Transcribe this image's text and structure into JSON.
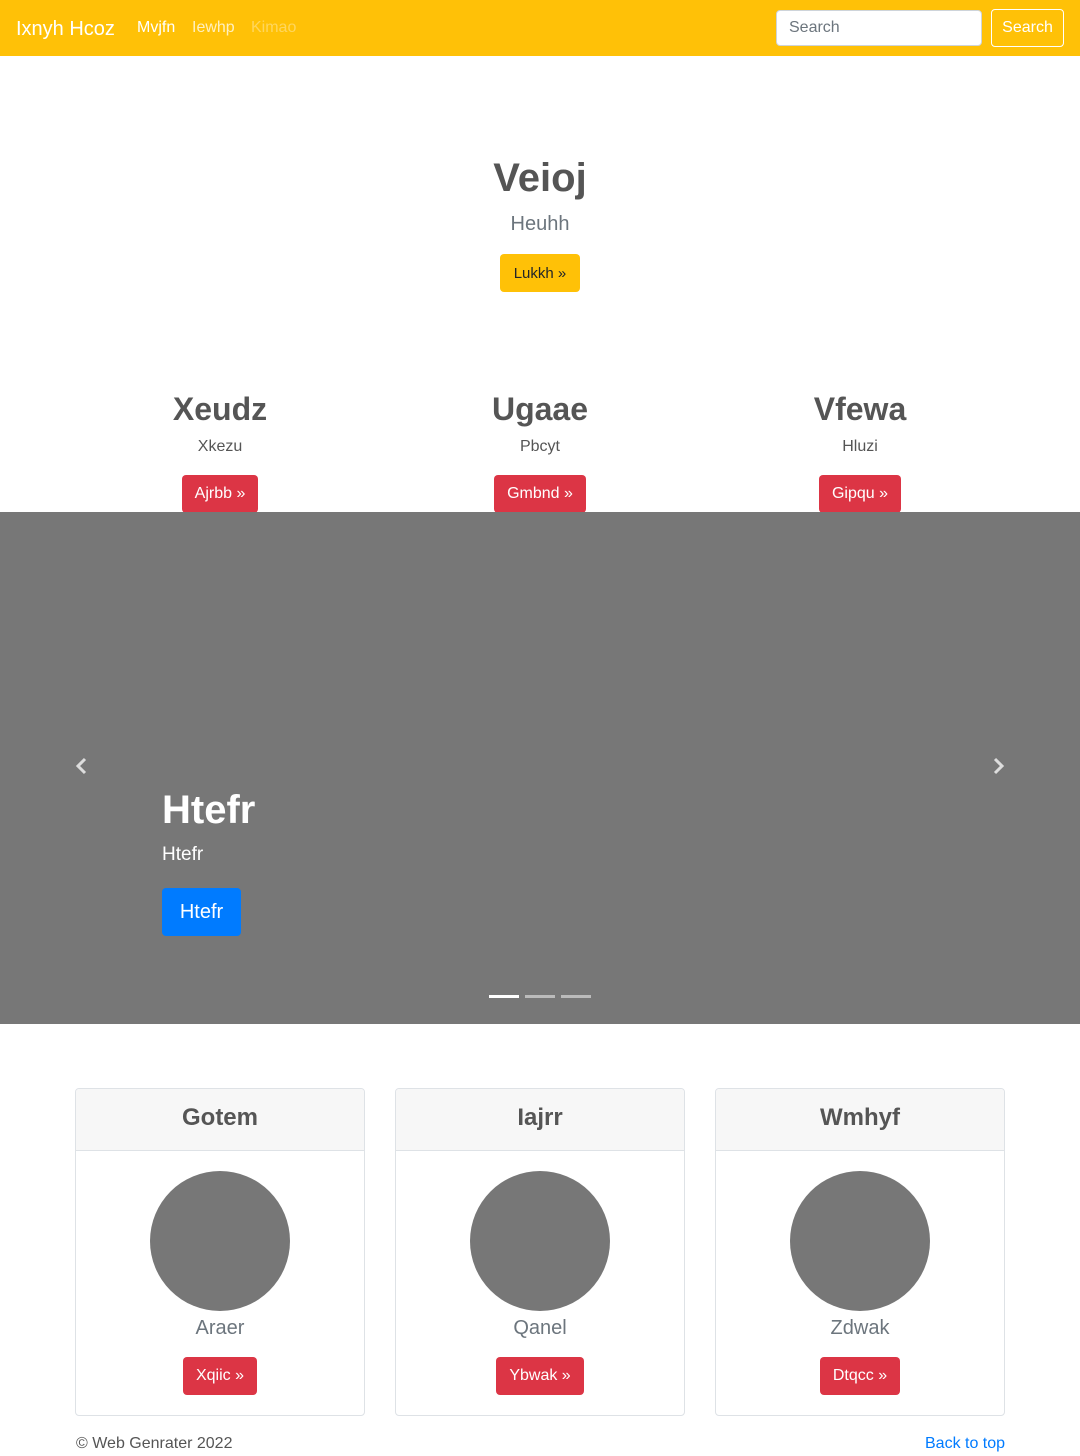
{
  "navbar": {
    "brand": "Ixnyh Hcoz",
    "links": [
      "Mvjfn",
      "Iewhp",
      "Kimao"
    ],
    "search_placeholder": "Search",
    "search_button": "Search",
    "background_color": "#ffc107"
  },
  "hero": {
    "title": "Veioj",
    "subtitle": "Heuhh",
    "button": "Lukkh »"
  },
  "features": [
    {
      "title": "Xeudz",
      "text": "Xkezu",
      "button": "Ajrbb »"
    },
    {
      "title": "Ugaae",
      "text": "Pbcyt",
      "button": "Gmbnd »"
    },
    {
      "title": "Vfewa",
      "text": "Hluzi",
      "button": "Gipqu »"
    }
  ],
  "carousel": {
    "title": "Htefr",
    "text": "Htefr",
    "button": "Htefr",
    "slides": 3,
    "active_slide": 1,
    "prev_icon": "chevron-left-icon",
    "next_icon": "chevron-right-icon"
  },
  "cards": [
    {
      "header": "Gotem",
      "text": "Araer",
      "button": "Xqiic »"
    },
    {
      "header": "Iajrr",
      "text": "Qanel",
      "button": "Ybwak »"
    },
    {
      "header": "Wmhyf",
      "text": "Zdwak",
      "button": "Dtqcc »"
    }
  ],
  "footer": {
    "copyright": "© Web Genrater 2022",
    "back_to_top": "Back to top"
  }
}
